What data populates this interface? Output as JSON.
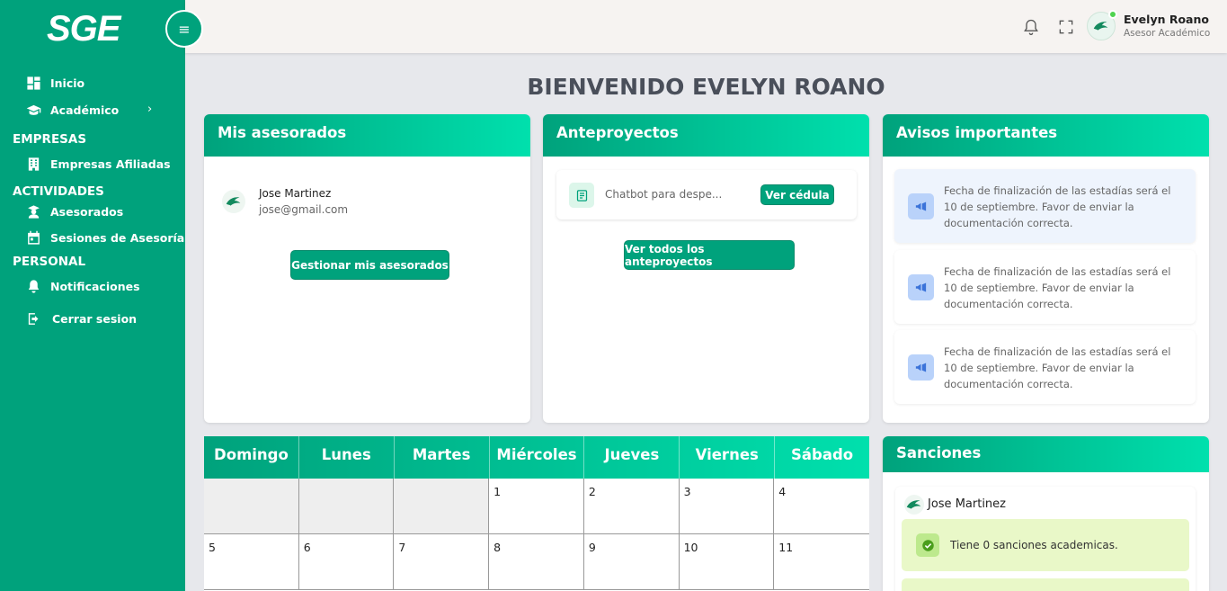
{
  "brand": {
    "logo": "SGE"
  },
  "sidebar": {
    "items": [
      {
        "label": "Inicio"
      },
      {
        "label": "Académico"
      }
    ],
    "sections": [
      {
        "title": "EMPRESAS",
        "items": [
          {
            "label": "Empresas Afiliadas"
          }
        ]
      },
      {
        "title": "ACTIVIDADES",
        "items": [
          {
            "label": "Asesorados"
          },
          {
            "label": "Sesiones de Asesoría"
          }
        ]
      },
      {
        "title": "PERSONAL",
        "items": [
          {
            "label": "Notificaciones"
          }
        ]
      }
    ],
    "logout": "Cerrar sesion"
  },
  "header": {
    "user_name": "Evelyn Roano",
    "user_role": "Asesor Académico"
  },
  "welcome": "BIENVENIDO EVELYN ROANO",
  "advisees": {
    "title": "Mis asesorados",
    "items": [
      {
        "name": "Jose Martinez",
        "email": "jose@gmail.com"
      }
    ],
    "button": "Gestionar mis asesorados"
  },
  "projects": {
    "title": "Anteproyectos",
    "items": [
      {
        "name": "Chatbot para despe...",
        "action": "Ver cédula"
      }
    ],
    "button": "Ver todos los anteproyectos"
  },
  "notices": {
    "title": "Avisos importantes",
    "items": [
      {
        "text": "Fecha de finalización de las estadías será el 10 de septiembre. Favor de enviar la documentación correcta."
      },
      {
        "text": "Fecha de finalización de las estadías será el 10 de septiembre. Favor de enviar la documentación correcta."
      },
      {
        "text": "Fecha de finalización de las estadías será el 10 de septiembre. Favor de enviar la documentación correcta."
      }
    ]
  },
  "calendar": {
    "days": [
      "Domingo",
      "Lunes",
      "Martes",
      "Miércoles",
      "Jueves",
      "Viernes",
      "Sábado"
    ],
    "cells": [
      "",
      "",
      "",
      "1",
      "2",
      "3",
      "4",
      "5",
      "6",
      "7",
      "8",
      "9",
      "10",
      "11"
    ]
  },
  "sanctions": {
    "title": "Sanciones",
    "student": "Jose Martinez",
    "status": "Tiene 0 sanciones academicas."
  },
  "colors": {
    "primary": "#00a27c",
    "accent": "#00e0ad",
    "notice_bg": "#eef4fd",
    "sanction_bg": "#e9f8c8"
  }
}
